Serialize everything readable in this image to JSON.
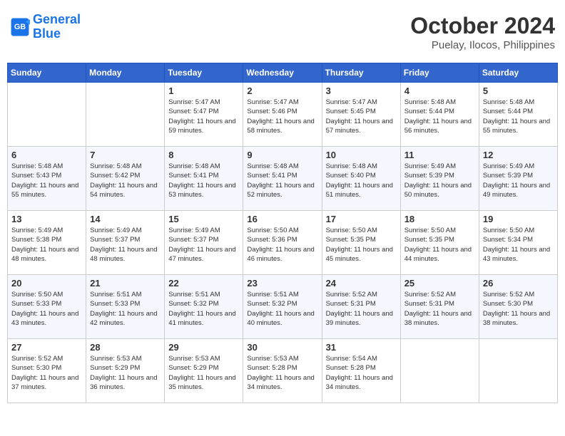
{
  "logo": {
    "line1": "General",
    "line2": "Blue"
  },
  "title": "October 2024",
  "subtitle": "Puelay, Ilocos, Philippines",
  "weekdays": [
    "Sunday",
    "Monday",
    "Tuesday",
    "Wednesday",
    "Thursday",
    "Friday",
    "Saturday"
  ],
  "weeks": [
    [
      {
        "day": "",
        "info": ""
      },
      {
        "day": "",
        "info": ""
      },
      {
        "day": "1",
        "info": "Sunrise: 5:47 AM\nSunset: 5:47 PM\nDaylight: 11 hours and 59 minutes."
      },
      {
        "day": "2",
        "info": "Sunrise: 5:47 AM\nSunset: 5:46 PM\nDaylight: 11 hours and 58 minutes."
      },
      {
        "day": "3",
        "info": "Sunrise: 5:47 AM\nSunset: 5:45 PM\nDaylight: 11 hours and 57 minutes."
      },
      {
        "day": "4",
        "info": "Sunrise: 5:48 AM\nSunset: 5:44 PM\nDaylight: 11 hours and 56 minutes."
      },
      {
        "day": "5",
        "info": "Sunrise: 5:48 AM\nSunset: 5:44 PM\nDaylight: 11 hours and 55 minutes."
      }
    ],
    [
      {
        "day": "6",
        "info": "Sunrise: 5:48 AM\nSunset: 5:43 PM\nDaylight: 11 hours and 55 minutes."
      },
      {
        "day": "7",
        "info": "Sunrise: 5:48 AM\nSunset: 5:42 PM\nDaylight: 11 hours and 54 minutes."
      },
      {
        "day": "8",
        "info": "Sunrise: 5:48 AM\nSunset: 5:41 PM\nDaylight: 11 hours and 53 minutes."
      },
      {
        "day": "9",
        "info": "Sunrise: 5:48 AM\nSunset: 5:41 PM\nDaylight: 11 hours and 52 minutes."
      },
      {
        "day": "10",
        "info": "Sunrise: 5:48 AM\nSunset: 5:40 PM\nDaylight: 11 hours and 51 minutes."
      },
      {
        "day": "11",
        "info": "Sunrise: 5:49 AM\nSunset: 5:39 PM\nDaylight: 11 hours and 50 minutes."
      },
      {
        "day": "12",
        "info": "Sunrise: 5:49 AM\nSunset: 5:39 PM\nDaylight: 11 hours and 49 minutes."
      }
    ],
    [
      {
        "day": "13",
        "info": "Sunrise: 5:49 AM\nSunset: 5:38 PM\nDaylight: 11 hours and 48 minutes."
      },
      {
        "day": "14",
        "info": "Sunrise: 5:49 AM\nSunset: 5:37 PM\nDaylight: 11 hours and 48 minutes."
      },
      {
        "day": "15",
        "info": "Sunrise: 5:49 AM\nSunset: 5:37 PM\nDaylight: 11 hours and 47 minutes."
      },
      {
        "day": "16",
        "info": "Sunrise: 5:50 AM\nSunset: 5:36 PM\nDaylight: 11 hours and 46 minutes."
      },
      {
        "day": "17",
        "info": "Sunrise: 5:50 AM\nSunset: 5:35 PM\nDaylight: 11 hours and 45 minutes."
      },
      {
        "day": "18",
        "info": "Sunrise: 5:50 AM\nSunset: 5:35 PM\nDaylight: 11 hours and 44 minutes."
      },
      {
        "day": "19",
        "info": "Sunrise: 5:50 AM\nSunset: 5:34 PM\nDaylight: 11 hours and 43 minutes."
      }
    ],
    [
      {
        "day": "20",
        "info": "Sunrise: 5:50 AM\nSunset: 5:33 PM\nDaylight: 11 hours and 43 minutes."
      },
      {
        "day": "21",
        "info": "Sunrise: 5:51 AM\nSunset: 5:33 PM\nDaylight: 11 hours and 42 minutes."
      },
      {
        "day": "22",
        "info": "Sunrise: 5:51 AM\nSunset: 5:32 PM\nDaylight: 11 hours and 41 minutes."
      },
      {
        "day": "23",
        "info": "Sunrise: 5:51 AM\nSunset: 5:32 PM\nDaylight: 11 hours and 40 minutes."
      },
      {
        "day": "24",
        "info": "Sunrise: 5:52 AM\nSunset: 5:31 PM\nDaylight: 11 hours and 39 minutes."
      },
      {
        "day": "25",
        "info": "Sunrise: 5:52 AM\nSunset: 5:31 PM\nDaylight: 11 hours and 38 minutes."
      },
      {
        "day": "26",
        "info": "Sunrise: 5:52 AM\nSunset: 5:30 PM\nDaylight: 11 hours and 38 minutes."
      }
    ],
    [
      {
        "day": "27",
        "info": "Sunrise: 5:52 AM\nSunset: 5:30 PM\nDaylight: 11 hours and 37 minutes."
      },
      {
        "day": "28",
        "info": "Sunrise: 5:53 AM\nSunset: 5:29 PM\nDaylight: 11 hours and 36 minutes."
      },
      {
        "day": "29",
        "info": "Sunrise: 5:53 AM\nSunset: 5:29 PM\nDaylight: 11 hours and 35 minutes."
      },
      {
        "day": "30",
        "info": "Sunrise: 5:53 AM\nSunset: 5:28 PM\nDaylight: 11 hours and 34 minutes."
      },
      {
        "day": "31",
        "info": "Sunrise: 5:54 AM\nSunset: 5:28 PM\nDaylight: 11 hours and 34 minutes."
      },
      {
        "day": "",
        "info": ""
      },
      {
        "day": "",
        "info": ""
      }
    ]
  ]
}
